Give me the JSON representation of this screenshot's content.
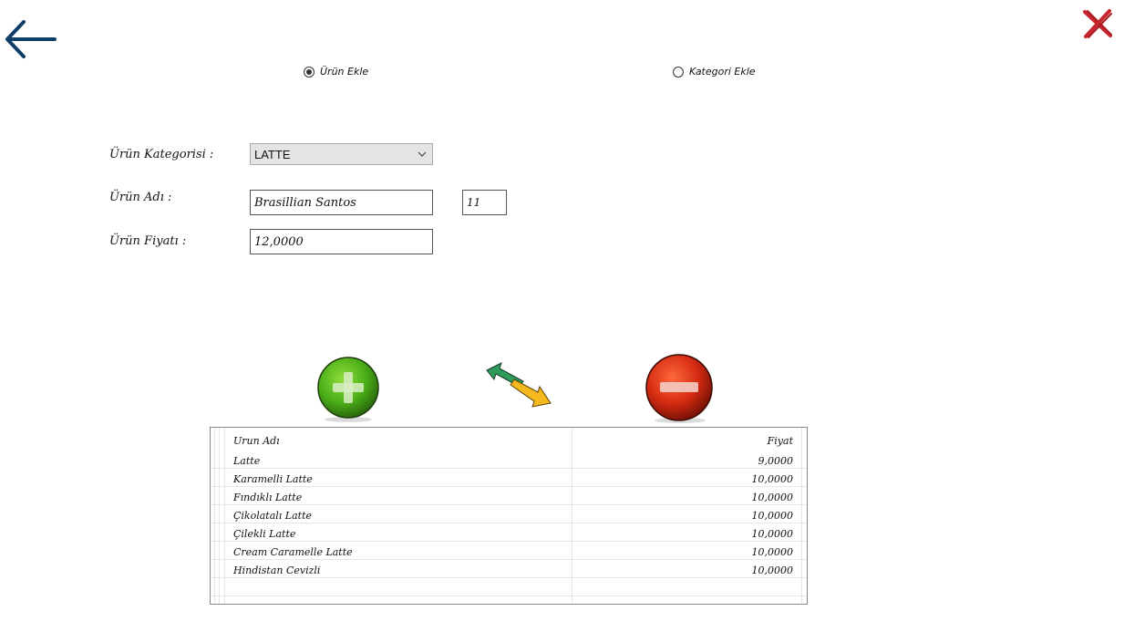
{
  "radios": [
    {
      "label": "Ürün Ekle",
      "checked": true
    },
    {
      "label": "Kategori Ekle",
      "checked": false
    }
  ],
  "form": {
    "category_label": "Ürün Kategorisi :",
    "category_value": "LATTE",
    "name_label": "Ürün Adı :",
    "name_value": "Brasillian Santos",
    "id_value": "11",
    "price_label": "Ürün Fiyatı :",
    "price_value": "12,0000"
  },
  "table": {
    "headers": [
      "Urun Adı",
      "Fiyat"
    ],
    "rows": [
      {
        "name": "Latte",
        "price": "9,0000"
      },
      {
        "name": "Karamelli Latte",
        "price": "10,0000"
      },
      {
        "name": "Fındıklı Latte",
        "price": "10,0000"
      },
      {
        "name": "Çikolatalı Latte",
        "price": "10,0000"
      },
      {
        "name": "Çilekli Latte",
        "price": "10,0000"
      },
      {
        "name": "Cream Caramelle Latte",
        "price": "10,0000"
      },
      {
        "name": "Hindistan Cevizli",
        "price": "10,0000"
      }
    ]
  },
  "icons": {
    "back": "arrow-left-icon",
    "close": "close-x-icon",
    "add": "plus-circle-icon",
    "swap": "swap-arrows-icon",
    "remove": "minus-circle-icon"
  },
  "colors": {
    "back_arrow": "#0f3f68",
    "close_x": "#c8262e",
    "add_green": "#4caf1a",
    "remove_red": "#d42b12",
    "swap_green": "#2e9a5c",
    "swap_yellow": "#f5b81e"
  }
}
